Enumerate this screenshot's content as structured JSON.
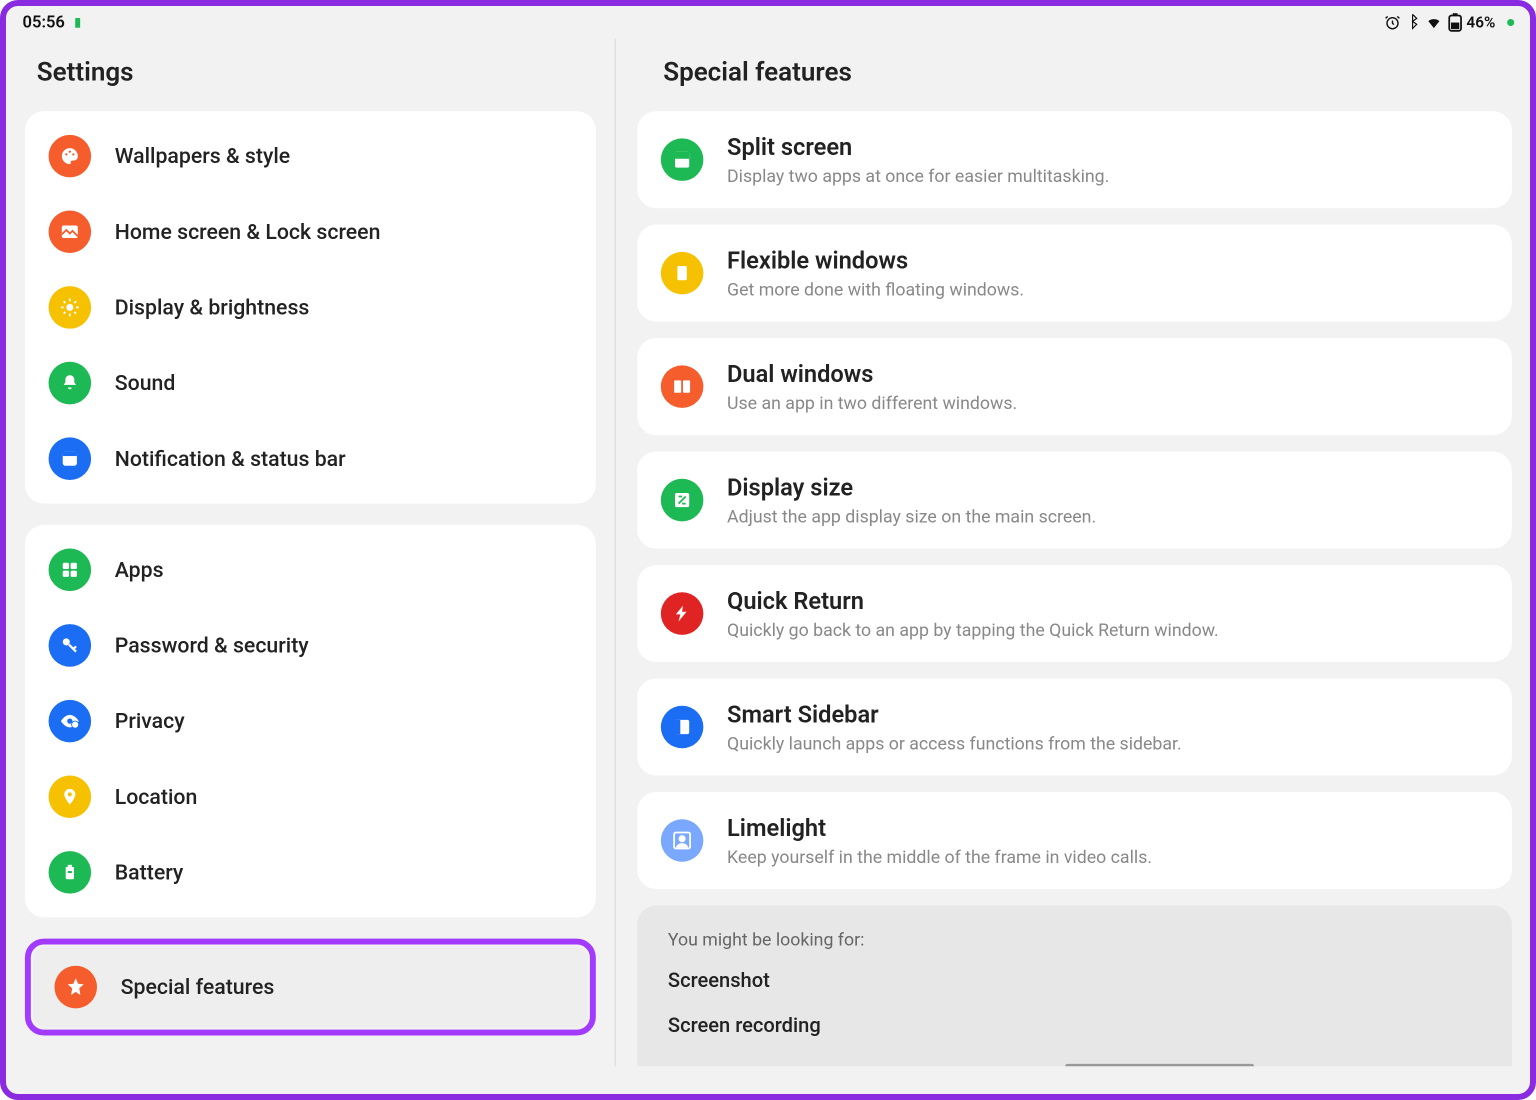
{
  "status": {
    "time": "05:56",
    "battery_pct": "46%"
  },
  "left_panel": {
    "title": "Settings",
    "group1": [
      {
        "label": "Wallpapers & style"
      },
      {
        "label": "Home screen & Lock screen"
      },
      {
        "label": "Display & brightness"
      },
      {
        "label": "Sound"
      },
      {
        "label": "Notification & status bar"
      }
    ],
    "group2": [
      {
        "label": "Apps"
      },
      {
        "label": "Password & security"
      },
      {
        "label": "Privacy"
      },
      {
        "label": "Location"
      },
      {
        "label": "Battery"
      }
    ],
    "selected": {
      "label": "Special features"
    }
  },
  "right_panel": {
    "title": "Special features",
    "features": [
      {
        "title": "Split screen",
        "desc": "Display two apps at once for easier multitasking."
      },
      {
        "title": "Flexible windows",
        "desc": "Get more done with floating windows."
      },
      {
        "title": "Dual windows",
        "desc": "Use an app in two different windows."
      },
      {
        "title": "Display size",
        "desc": "Adjust the app display size on the main screen."
      },
      {
        "title": "Quick Return",
        "desc": "Quickly go back to an app by tapping the Quick Return window."
      },
      {
        "title": "Smart Sidebar",
        "desc": "Quickly launch apps or access functions from the sidebar."
      },
      {
        "title": "Limelight",
        "desc": "Keep yourself in the middle of the frame in video calls."
      }
    ],
    "suggest": {
      "label": "You might be looking for:",
      "items": [
        "Screenshot",
        "Screen recording"
      ]
    }
  }
}
